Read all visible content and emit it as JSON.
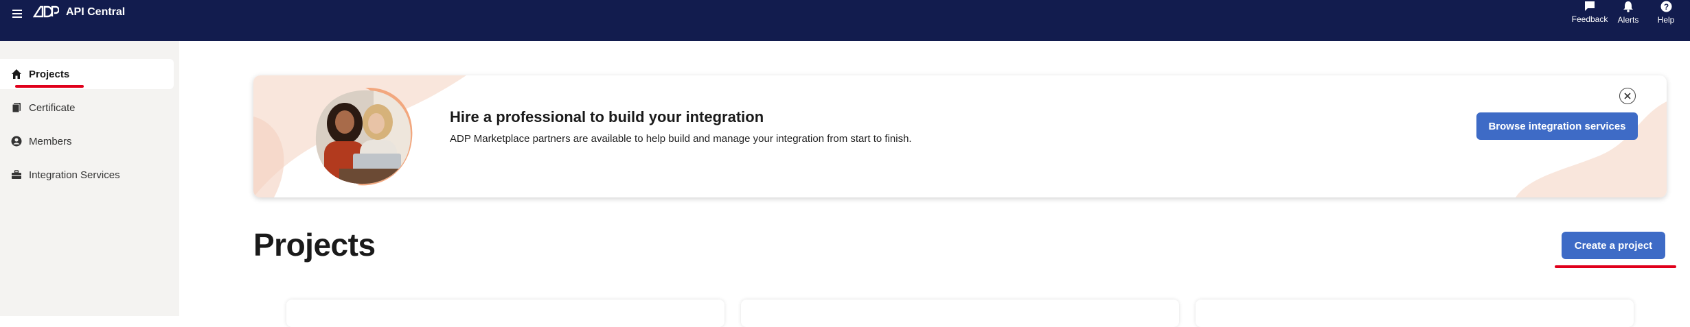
{
  "header": {
    "app_title": "API Central",
    "brand": "ADP",
    "actions": [
      {
        "label": "Feedback",
        "icon": "chat-icon"
      },
      {
        "label": "Alerts",
        "icon": "bell-icon"
      },
      {
        "label": "Help",
        "icon": "help-icon"
      }
    ]
  },
  "sidebar": {
    "items": [
      {
        "label": "Projects",
        "icon": "home-icon",
        "active": true
      },
      {
        "label": "Certificate",
        "icon": "certificate-icon",
        "active": false
      },
      {
        "label": "Members",
        "icon": "person-icon",
        "active": false
      },
      {
        "label": "Integration Services",
        "icon": "briefcase-icon",
        "active": false
      }
    ]
  },
  "banner": {
    "title": "Hire a professional to build your integration",
    "text": "ADP Marketplace partners are available to help build and manage your integration from start to finish.",
    "button_label": "Browse integration services"
  },
  "main": {
    "page_title": "Projects",
    "create_button_label": "Create a project"
  },
  "colors": {
    "header_bg": "#121c4e",
    "primary_button": "#3e6bc6",
    "annotation_red": "#e0001b",
    "sidebar_bg": "#f4f3f1"
  }
}
